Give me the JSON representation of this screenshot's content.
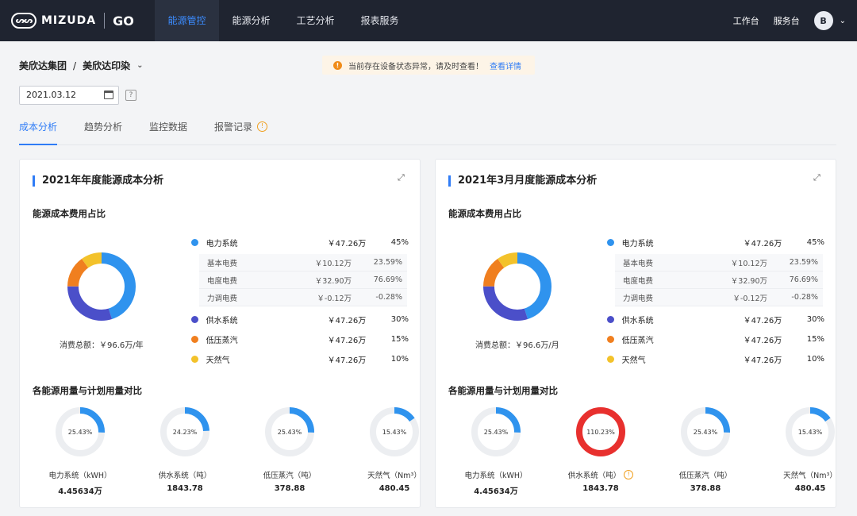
{
  "header": {
    "logo_badge": "ᔕᔕ",
    "logo_text": "MIZUDA",
    "logo_mark": "GO",
    "nav": [
      "能源管控",
      "能源分析",
      "工艺分析",
      "报表服务"
    ],
    "nav_active": 0,
    "workbench": "工作台",
    "service": "服务台",
    "avatar": "B",
    "chevron": "⌄"
  },
  "breadcrumb": {
    "group": "美欣达集团",
    "sep": "/",
    "company": "美欣达印染",
    "dropdown": "⌄"
  },
  "alert": {
    "icon": "!",
    "text": "当前存在设备状态异常，请及时查看！",
    "link": "查看详情"
  },
  "date": {
    "value": "2021.03.12",
    "help": "?"
  },
  "tabs": [
    {
      "label": "成本分析"
    },
    {
      "label": "趋势分析"
    },
    {
      "label": "监控数据"
    },
    {
      "label": "报警记录",
      "warn": "!"
    }
  ],
  "colors": {
    "electric": "#2f93ee",
    "water": "#4b4fc9",
    "steam": "#f07f1f",
    "gas": "#f3c22b",
    "alarm": "#e8302e",
    "track": "#eceef1"
  },
  "panels": [
    {
      "title": "2021年年度能源成本分析",
      "share_title": "能源成本费用占比",
      "total": "消费总额：￥96.6万/年",
      "compare_title": "各能源用量与计划用量对比",
      "legend": [
        {
          "name": "电力系统",
          "value": "￥47.26万",
          "pct": "45%",
          "color": "#2f93ee",
          "sub": [
            {
              "name": "基本电费",
              "value": "￥10.12万",
              "pct": "23.59%"
            },
            {
              "name": "电度电费",
              "value": "￥32.90万",
              "pct": "76.69%"
            },
            {
              "name": "力调电费",
              "value": "￥-0.12万",
              "pct": "-0.28%"
            }
          ]
        },
        {
          "name": "供水系统",
          "value": "￥47.26万",
          "pct": "30%",
          "color": "#4b4fc9"
        },
        {
          "name": "低压蒸汽",
          "value": "￥47.26万",
          "pct": "15%",
          "color": "#f07f1f"
        },
        {
          "name": "天然气",
          "value": "￥47.26万",
          "pct": "10%",
          "color": "#f3c22b"
        }
      ],
      "donut": {
        "electric": 45,
        "water": 30,
        "steam": 15,
        "gas": 10
      },
      "gauges": [
        {
          "pct_label": "25.43%",
          "fraction": 0.2543,
          "label": "电力系统（kWH）",
          "value": "4.45634万",
          "alarm": false
        },
        {
          "pct_label": "24.23%",
          "fraction": 0.2423,
          "label": "供水系统（吨）",
          "value": "1843.78",
          "alarm": false
        },
        {
          "pct_label": "25.43%",
          "fraction": 0.2543,
          "label": "低压蒸汽（吨）",
          "value": "378.88",
          "alarm": false
        },
        {
          "pct_label": "15.43%",
          "fraction": 0.1543,
          "label": "天然气（Nm³）",
          "value": "480.45",
          "alarm": false
        }
      ]
    },
    {
      "title": "2021年3月月度能源成本分析",
      "share_title": "能源成本费用占比",
      "total": "消费总额：￥96.6万/月",
      "compare_title": "各能源用量与计划用量对比",
      "legend": [
        {
          "name": "电力系统",
          "value": "￥47.26万",
          "pct": "45%",
          "color": "#2f93ee",
          "sub": [
            {
              "name": "基本电费",
              "value": "￥10.12万",
              "pct": "23.59%"
            },
            {
              "name": "电度电费",
              "value": "￥32.90万",
              "pct": "76.69%"
            },
            {
              "name": "力调电费",
              "value": "￥-0.12万",
              "pct": "-0.28%"
            }
          ]
        },
        {
          "name": "供水系统",
          "value": "￥47.26万",
          "pct": "30%",
          "color": "#4b4fc9"
        },
        {
          "name": "低压蒸汽",
          "value": "￥47.26万",
          "pct": "15%",
          "color": "#f07f1f"
        },
        {
          "name": "天然气",
          "value": "￥47.26万",
          "pct": "10%",
          "color": "#f3c22b"
        }
      ],
      "donut": {
        "electric": 45,
        "water": 30,
        "steam": 15,
        "gas": 10
      },
      "gauges": [
        {
          "pct_label": "25.43%",
          "fraction": 0.2543,
          "label": "电力系统（kWH）",
          "value": "4.45634万",
          "alarm": false
        },
        {
          "pct_label": "110.23%",
          "fraction": 1.1023,
          "label": "供水系统（吨）",
          "value": "1843.78",
          "alarm": true,
          "warn": "!"
        },
        {
          "pct_label": "25.43%",
          "fraction": 0.2543,
          "label": "低压蒸汽（吨）",
          "value": "378.88",
          "alarm": false
        },
        {
          "pct_label": "15.43%",
          "fraction": 0.1543,
          "label": "天然气（Nm³）",
          "value": "480.45",
          "alarm": false
        }
      ]
    }
  ]
}
